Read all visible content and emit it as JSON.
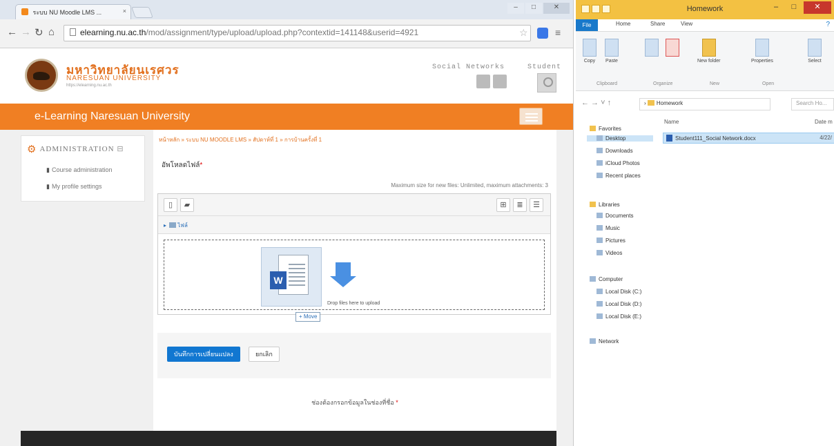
{
  "chrome": {
    "tab_title": "ระบบ NU Moodle LMS ...",
    "tab_close": "×",
    "url_host": "elearning.nu.ac.th",
    "url_path": "/mod/assignment/type/upload/upload.php?contextid=141148&userid=4921",
    "minimize": "–",
    "maximize": "□",
    "close": "✕"
  },
  "site": {
    "brand_th": "มหาวิทยาลัยนเรศวร",
    "brand_en": "NARESUAN UNIVERSITY",
    "brand_url": "https://elearning.nu.ac.th",
    "social_label": "Social Networks",
    "student_label": "Student",
    "course_title": "e-Learning Naresuan University"
  },
  "admin": {
    "title": "ADMINISTRATION",
    "items": [
      {
        "label": "Course administration"
      },
      {
        "label": "My profile settings"
      }
    ]
  },
  "main": {
    "breadcrumb": "หน้าหลัก » ระบบ NU MOODLE LMS » สัปดาห์ที่ 1 » การบ้านครั้งที่ 1",
    "field_label": "อัพโหลดไฟล์",
    "max_note": "Maximum size for new files: Unlimited, maximum attachments: 3",
    "path_label": "ไฟล์",
    "drop_text": "Drop files here to upload",
    "move_tip": "+ Move",
    "save_button": "บันทึกการเปลี่ยนแปลง",
    "cancel_button": "ยกเลิก",
    "required_note": "ช่องต้องกรอกข้อมูลในช่องที่ชื่อ"
  },
  "explorer": {
    "title": "Homework",
    "tabs": {
      "file": "File",
      "home": "Home",
      "share": "Share",
      "view": "View"
    },
    "ribbon": {
      "copy": "Copy",
      "paste": "Paste",
      "new_folder": "New folder",
      "properties": "Properties",
      "select": "Select",
      "groups": [
        "Clipboard",
        "Organize",
        "New",
        "Open"
      ]
    },
    "address": "Homework",
    "search_placeholder": "Search Ho...",
    "tree": {
      "favorites": "Favorites",
      "desktop": "Desktop",
      "downloads": "Downloads",
      "icloud": "iCloud Photos",
      "recent": "Recent places",
      "libraries": "Libraries",
      "documents": "Documents",
      "music": "Music",
      "pictures": "Pictures",
      "videos": "Videos",
      "computer": "Computer",
      "disk_c": "Local Disk (C:)",
      "disk_d": "Local Disk (D:)",
      "disk_e": "Local Disk (E:)",
      "network": "Network"
    },
    "columns": {
      "name": "Name",
      "date": "Date m"
    },
    "file": {
      "name": "Student111_Social Network.docx",
      "date": "4/22/"
    }
  }
}
